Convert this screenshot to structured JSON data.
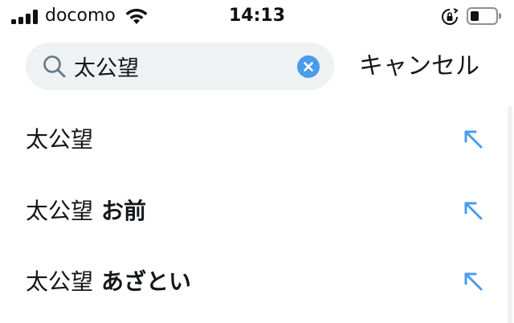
{
  "status_bar": {
    "carrier": "docomo",
    "time": "14:13"
  },
  "search": {
    "query": "太公望",
    "cancel_label": "キャンセル"
  },
  "suggestions": [
    {
      "query": "太公望",
      "completion": ""
    },
    {
      "query": "太公望",
      "completion": "お前"
    },
    {
      "query": "太公望",
      "completion": "あざとい"
    }
  ],
  "colors": {
    "accent": "#4a9ce8",
    "search_background": "#eef2f3"
  },
  "icons": {
    "signal": "cellular-signal-icon",
    "wifi": "wifi-icon",
    "orientation_lock": "orientation-lock-icon",
    "battery": "battery-icon",
    "search": "search-icon",
    "clear": "clear-icon",
    "fill": "arrow-up-left-icon"
  }
}
